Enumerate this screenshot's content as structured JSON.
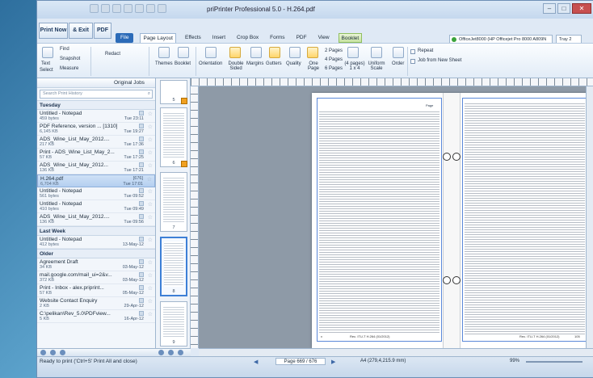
{
  "window": {
    "title": "priPrinter Professional 5.0 - H.264.pdf"
  },
  "top_buttons": {
    "print_now": "Print Now",
    "exit": "& Exit",
    "pdf": "PDF"
  },
  "tabs": [
    "File",
    "Page Layout",
    "Effects",
    "Insert",
    "Crop Box",
    "Forms",
    "PDF",
    "View",
    "Booklet"
  ],
  "printer": {
    "name": "OfficeJet8000 (HP Officejet Pro 8000 A809N",
    "tray": "Tray 2"
  },
  "ribbon": {
    "text": "Text",
    "select": "Select",
    "find": "Find",
    "snapshot": "Snapshot",
    "measure": "Measure",
    "redact": "Redact",
    "themes": "Themes",
    "booklet": "Booklet",
    "orientation": "Orientation",
    "double_sided": "Double Sided",
    "margins": "Margins",
    "gutters": "Gutters",
    "quality": "Quality",
    "one_page": "One Page",
    "pages2": "2 Pages",
    "pages4": "4 Pages",
    "pages6": "6 Pages",
    "pages_grid": "(4 pages) 1 x 4",
    "uniform_scale": "Uniform Scale",
    "order": "Order",
    "repeat": "Repeat",
    "job_new_sheet": "Job from New Sheet"
  },
  "jobs_panel": {
    "header": "Original Jobs",
    "search_placeholder": "Search Print History",
    "groups": [
      {
        "name": "Tuesday",
        "jobs": [
          {
            "name": "Untitled - Notepad",
            "size": "459 bytes",
            "time": "Tue 23:11"
          },
          {
            "name": "PDF Reference, version ... [1310]",
            "size": "6,145 KB",
            "time": "Tue 19:27"
          },
          {
            "name": "ADS_Wine_List_May_2012....",
            "size": "217 KB",
            "time": "Tue 17:36"
          },
          {
            "name": "Print - ADS_Wine_List_May_2...",
            "size": "57 KB",
            "time": "Tue 17:25"
          },
          {
            "name": "ADS_Wine_List_May_2012...",
            "size": "136 KB",
            "time": "Tue 17:21"
          },
          {
            "name": "H.264.pdf",
            "size": "6,704 KB",
            "time": "Tue 17:01",
            "extra": "[676]",
            "selected": true
          },
          {
            "name": "Untitled - Notepad",
            "size": "561 bytes",
            "time": "Tue 09:52"
          },
          {
            "name": "Untitled - Notepad",
            "size": "410 bytes",
            "time": "Tue 09:49"
          },
          {
            "name": "ADS_Wine_List_May_2012....",
            "size": "136 KB",
            "time": "Tue 09:56"
          }
        ]
      },
      {
        "name": "Last Week",
        "jobs": [
          {
            "name": "Untitled - Notepad",
            "size": "412 bytes",
            "time": "13-May-12"
          }
        ]
      },
      {
        "name": "Older",
        "jobs": [
          {
            "name": "Agreement Draft",
            "size": "34 KB",
            "time": "03-May-12"
          },
          {
            "name": "mail.google.com/mail_ui=2&v...",
            "size": "372 KB",
            "time": "03-May-12"
          },
          {
            "name": "Print - Inbox - alex.priprint...",
            "size": "57 KB",
            "time": "05-May-12"
          },
          {
            "name": "Website Contact Enquiry",
            "size": "2 KB",
            "time": "29-Apr-12"
          },
          {
            "name": "C:\\pelikan\\Rev_5.0\\PDFview...",
            "size": "5 KB",
            "time": "16-Apr-12"
          }
        ]
      }
    ]
  },
  "thumbnails": [
    "5",
    "6",
    "7",
    "8",
    "9"
  ],
  "document": {
    "left_footer": "Rec. ITU-T H.264 (01/2012)",
    "left_page": "v",
    "right_footer": "Rec. ITU-T H.264 (01/2012)",
    "right_page": "105",
    "index_label": "Page"
  },
  "statusbar": {
    "status": "Ready to print ('Ctrl+S' Print All and close)",
    "page": "Page 669 / 676",
    "paper": "A4 (279,4,215.9 mm)",
    "zoom": "99%"
  }
}
